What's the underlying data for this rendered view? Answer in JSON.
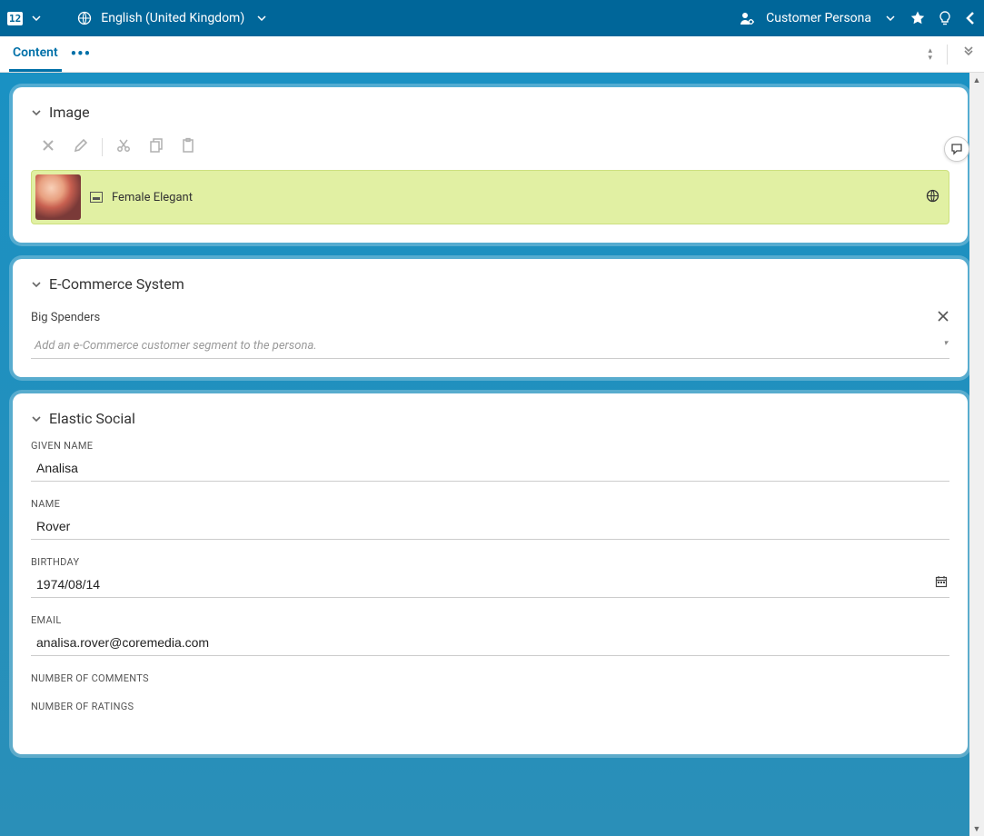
{
  "header": {
    "doc_badge": "12",
    "language": "English (United Kingdom)",
    "persona_label": "Customer Persona"
  },
  "tabs": {
    "active": "Content"
  },
  "panels": {
    "image": {
      "title": "Image",
      "linked_item_label": "Female Elegant"
    },
    "ecommerce": {
      "title": "E-Commerce System",
      "segment": "Big Spenders",
      "placeholder": "Add an e-Commerce customer segment to the persona."
    },
    "elastic_social": {
      "title": "Elastic Social",
      "fields": {
        "given_name": {
          "label": "GIVEN NAME",
          "value": "Analisa"
        },
        "name": {
          "label": "NAME",
          "value": "Rover"
        },
        "birthday": {
          "label": "BIRTHDAY",
          "value": "1974/08/14"
        },
        "email": {
          "label": "EMAIL",
          "value": "analisa.rover@coremedia.com"
        },
        "num_comments": {
          "label": "NUMBER OF COMMENTS",
          "value": ""
        },
        "num_ratings": {
          "label": "NUMBER OF RATINGS",
          "value": ""
        }
      }
    }
  }
}
